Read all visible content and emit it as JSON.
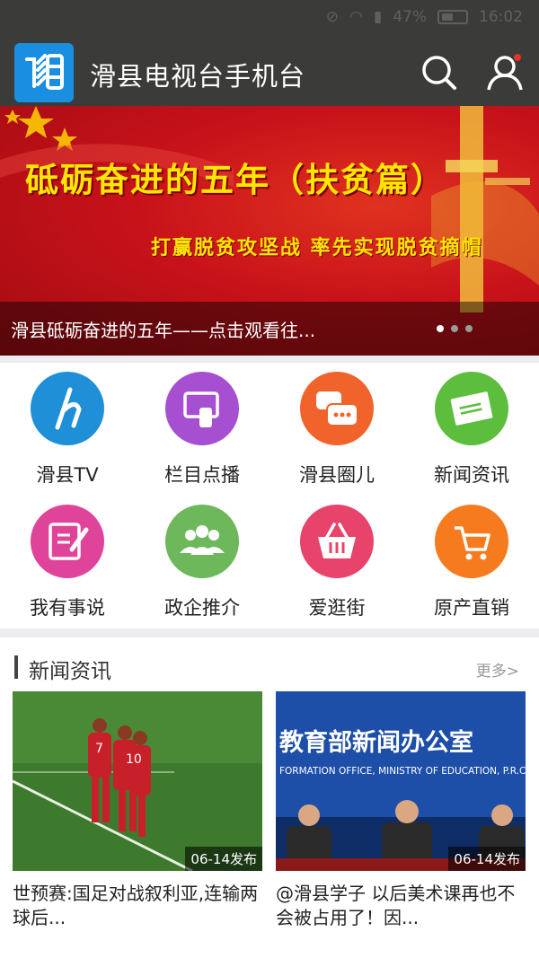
{
  "status": {
    "battery": "47%",
    "time": "16:02"
  },
  "header": {
    "logo_icon": "hua-logo",
    "title": "滑县电视台手机台",
    "search_icon": "search-icon",
    "user_icon": "user-icon"
  },
  "banner": {
    "headline": "砥砺奋进的五年（扶贫篇）",
    "subline": "打赢脱贫攻坚战  率先实现脱贫摘帽",
    "caption": "滑县砥砺奋进的五年——点击观看往...",
    "page_count": 3,
    "active_page": 1
  },
  "grid": {
    "items": [
      {
        "label": "滑县TV",
        "icon": "h-script-icon",
        "color": "#1f8fd8"
      },
      {
        "label": "栏目点播",
        "icon": "tv-touch-icon",
        "color": "#a64fd1"
      },
      {
        "label": "滑县圈儿",
        "icon": "chat-bubbles-icon",
        "color": "#f0642c"
      },
      {
        "label": "新闻资讯",
        "icon": "newspaper-icon",
        "color": "#5dbe3d"
      },
      {
        "label": "我有事说",
        "icon": "note-pen-icon",
        "color": "#e0449a"
      },
      {
        "label": "政企推介",
        "icon": "people-icon",
        "color": "#6cb85a"
      },
      {
        "label": "爱逛街",
        "icon": "basket-icon",
        "color": "#e8436b"
      },
      {
        "label": "原产直销",
        "icon": "cart-icon",
        "color": "#f57b1e"
      }
    ]
  },
  "news": {
    "title": "新闻资讯",
    "more": "更多>",
    "cards": [
      {
        "date": "06-14发布",
        "text": "世预赛:国足对战叙利亚,连输两球后...",
        "photo_numbers": [
          "7",
          "10"
        ]
      },
      {
        "date": "06-14发布",
        "text": "@滑县学子   以后美术课再也不会被占用了！因...",
        "photo_banner": "教育部新闻办公室",
        "photo_banner_sub": "FORMATION OFFICE, MINISTRY OF EDUCATION, P.R.C"
      }
    ]
  }
}
